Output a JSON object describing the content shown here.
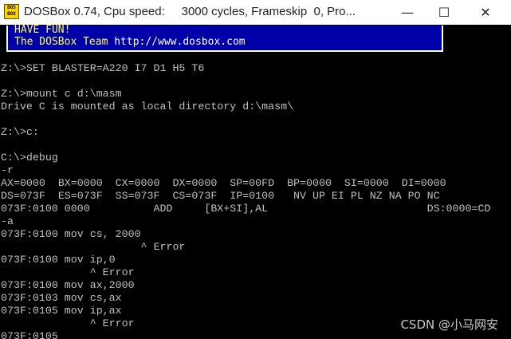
{
  "window": {
    "title": "DOSBox 0.74, Cpu speed:     3000 cycles, Frameskip  0, Pro...",
    "icon": "dosbox-icon",
    "icon_text_top": "DOS",
    "icon_text_bottom": "BOX",
    "minimize_glyph": "—",
    "maximize_glyph": "☐",
    "close_glyph": "✕"
  },
  "banner": {
    "line1": "HAVE FUN!",
    "line2_prefix": "The DOSBox Team ",
    "line2_url": "http://www.dosbox.com"
  },
  "console": {
    "lines": [
      "Z:\\>SET BLASTER=A220 I7 D1 H5 T6",
      "",
      "Z:\\>mount c d:\\masm",
      "Drive C is mounted as local directory d:\\masm\\",
      "",
      "Z:\\>c:",
      "",
      "C:\\>debug",
      "-r",
      "AX=0000  BX=0000  CX=0000  DX=0000  SP=00FD  BP=0000  SI=0000  DI=0000",
      "DS=073F  ES=073F  SS=073F  CS=073F  IP=0100   NV UP EI PL NZ NA PO NC",
      "073F:0100 0000          ADD     [BX+SI],AL                         DS:0000=CD",
      "-a",
      "073F:0100 mov cs, 2000",
      "                      ^ Error",
      "073F:0100 mov ip,0",
      "              ^ Error",
      "073F:0100 mov ax,2000",
      "073F:0103 mov cs,ax",
      "073F:0105 mov ip,ax",
      "              ^ Error",
      "073F:0105"
    ]
  },
  "watermark": "CSDN @小马网安",
  "colors": {
    "console_bg": "#000000",
    "console_text": "#c0c0c0",
    "banner_bg": "#0000a8",
    "banner_text": "#ffff55"
  }
}
